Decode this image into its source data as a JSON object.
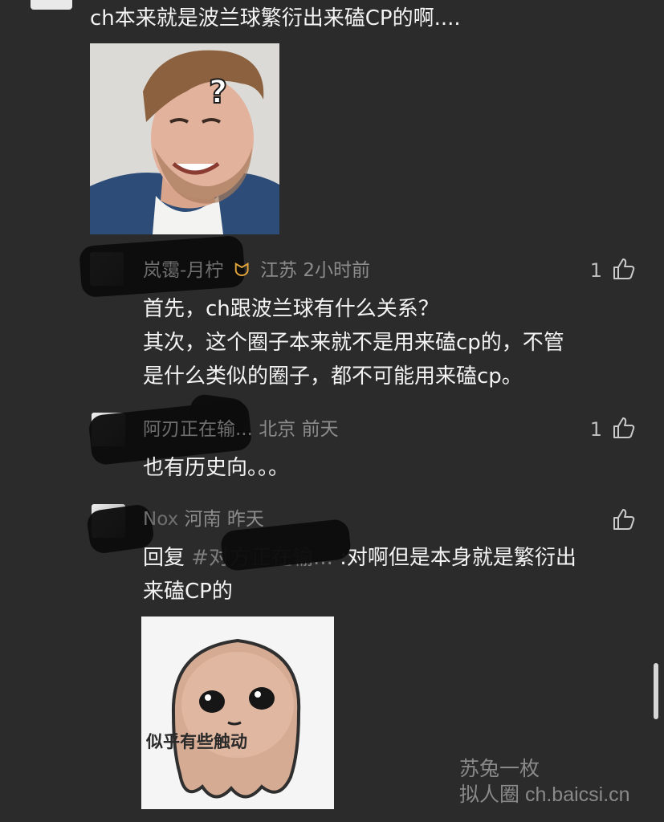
{
  "post": {
    "text": "ch本来就是波兰球繁衍出来磕CP的啊...."
  },
  "comments": [
    {
      "name": "岚霭-月柠",
      "location": "江苏",
      "time": "2小时前",
      "likes": "1",
      "lines": [
        "首先，ch跟波兰球有什么关系？",
        "其次，这个圈子本来就不是用来磕cp的，不管",
        "是什么类似的圈子，都不可能用来磕cp。"
      ]
    },
    {
      "name": "阿刃正在输...",
      "location": "北京",
      "time": "前天",
      "likes": "1",
      "lines": [
        "也有历史向。。。"
      ]
    },
    {
      "name": "Nox",
      "location": "河南",
      "time": "昨天",
      "likes": "",
      "reply_prefix": "回复 ",
      "reply_ref": "#对方正在输...",
      "reply_rest": " :对啊但是本身就是繁衍出",
      "line2": "来磕CP的",
      "sticker_caption": "似乎有些触动"
    }
  ],
  "watermark": {
    "line1": "苏兔一枚",
    "line2": "拟人圈 ch.baicsi.cn"
  },
  "colors": {
    "background": "#2b2b2b",
    "text": "#f3f3f3",
    "meta": "#8c8c8c",
    "badge": "#e0a23a"
  }
}
